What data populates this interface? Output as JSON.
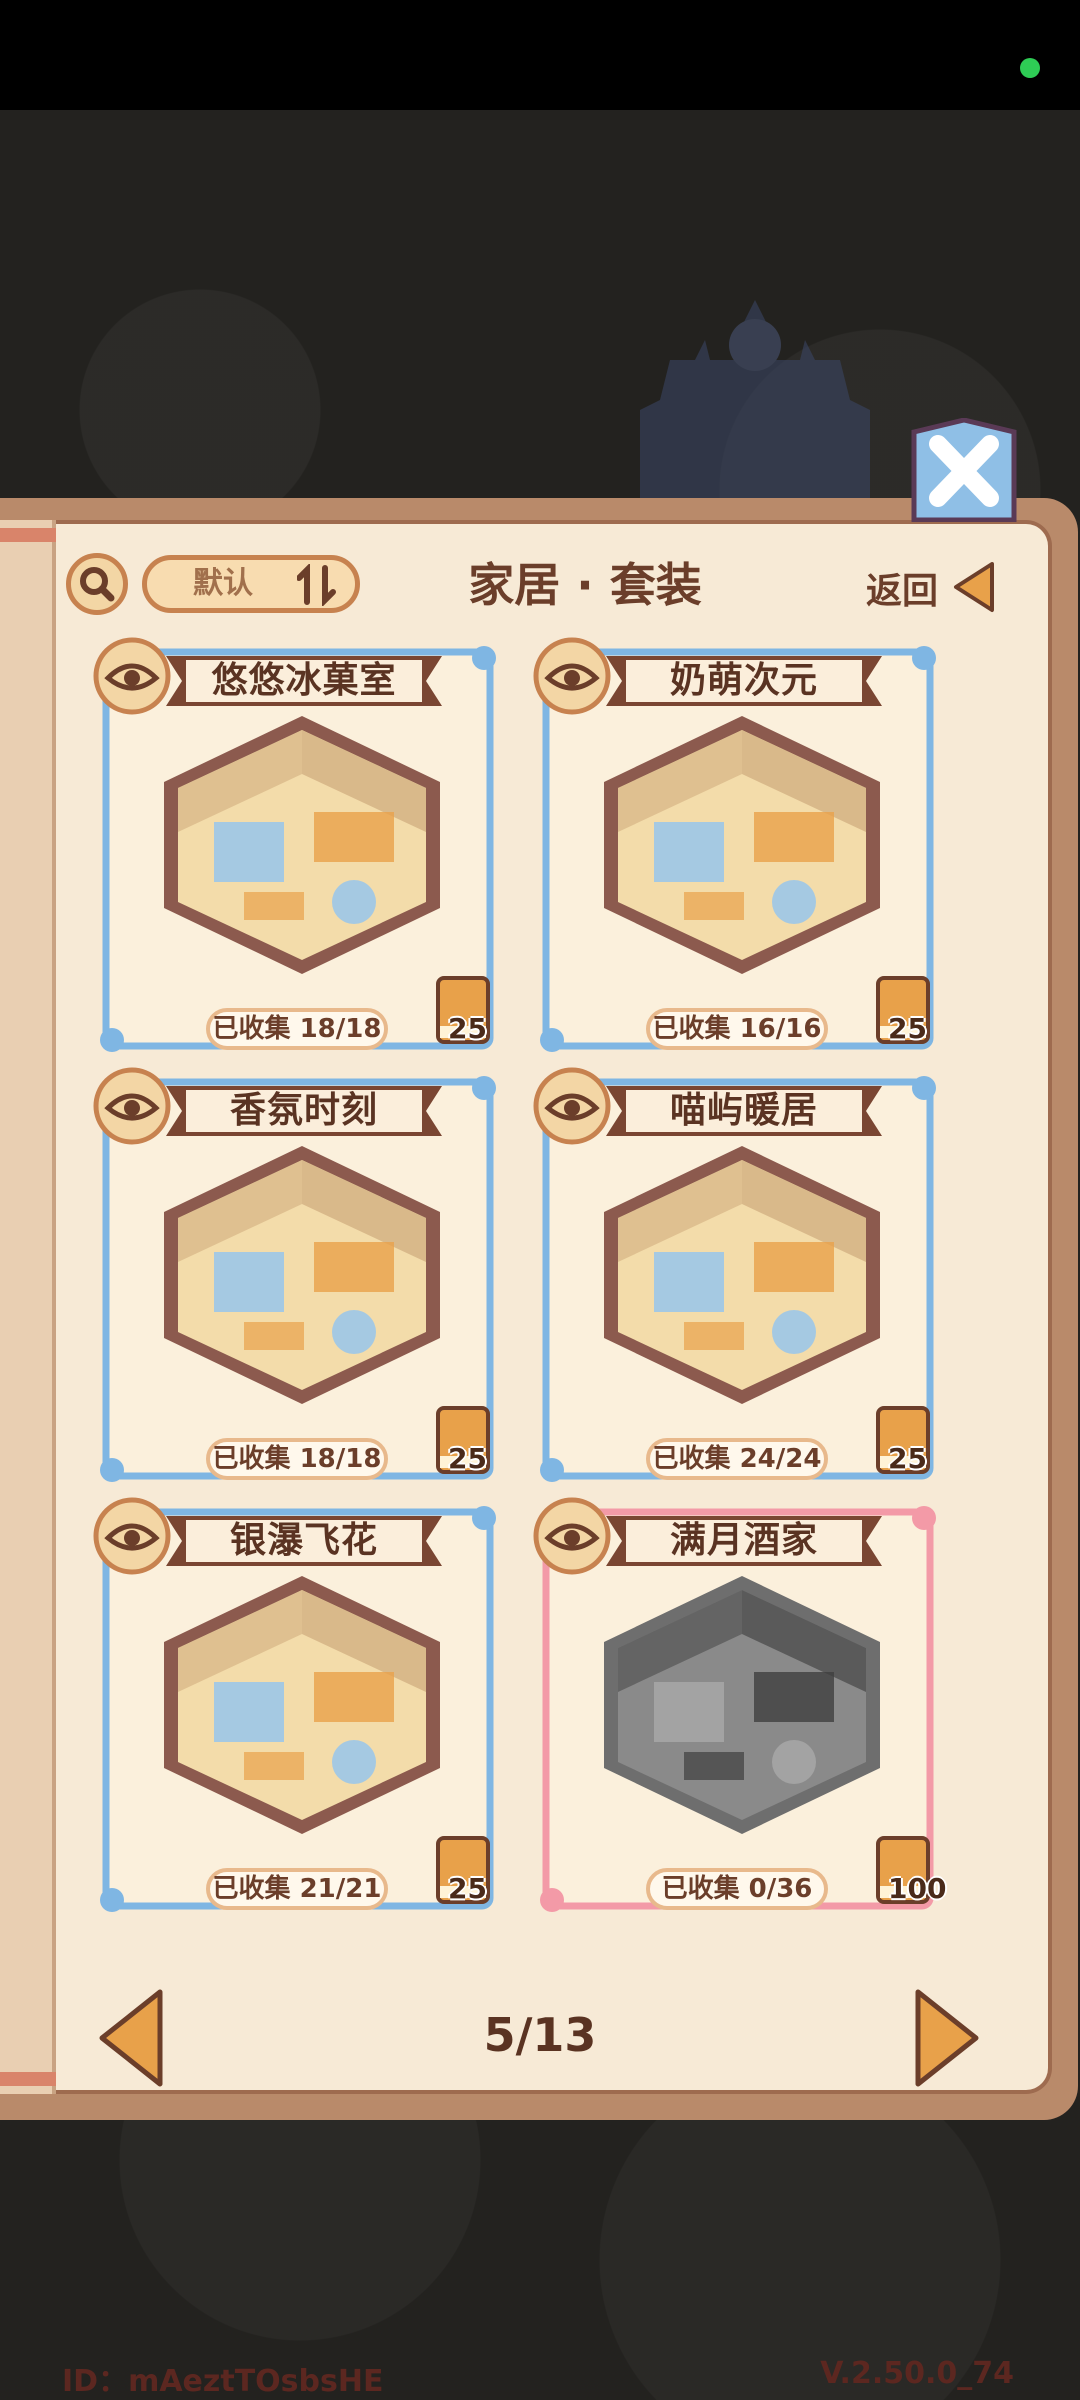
{
  "header": {
    "sort_label": "默认",
    "title": "家居 · 套装",
    "back_label": "返回"
  },
  "cards": [
    {
      "title": "悠悠冰菓室",
      "collected": "已收集 18/18",
      "reward": "25",
      "frame": "blue",
      "style": "color"
    },
    {
      "title": "奶萌次元",
      "collected": "已收集 16/16",
      "reward": "25",
      "frame": "blue",
      "style": "color"
    },
    {
      "title": "香氛时刻",
      "collected": "已收集 18/18",
      "reward": "25",
      "frame": "blue",
      "style": "color"
    },
    {
      "title": "喵屿暖居",
      "collected": "已收集 24/24",
      "reward": "25",
      "frame": "blue",
      "style": "color"
    },
    {
      "title": "银瀑飞花",
      "collected": "已收集 21/21",
      "reward": "25",
      "frame": "blue",
      "style": "color"
    },
    {
      "title": "满月酒家",
      "collected": "已收集 0/36",
      "reward": "100",
      "frame": "pink",
      "style": "grayscale"
    }
  ],
  "pager": {
    "text": "5/13"
  },
  "footer": {
    "id_text": "ID：mAeztTOsbsHE",
    "version": "V.2.50.0_74"
  },
  "colors": {
    "frame_blue": "#7fb6e3",
    "frame_pink": "#f39aa7",
    "accent_orange": "#e8a14a",
    "text_brown": "#5a3322"
  }
}
